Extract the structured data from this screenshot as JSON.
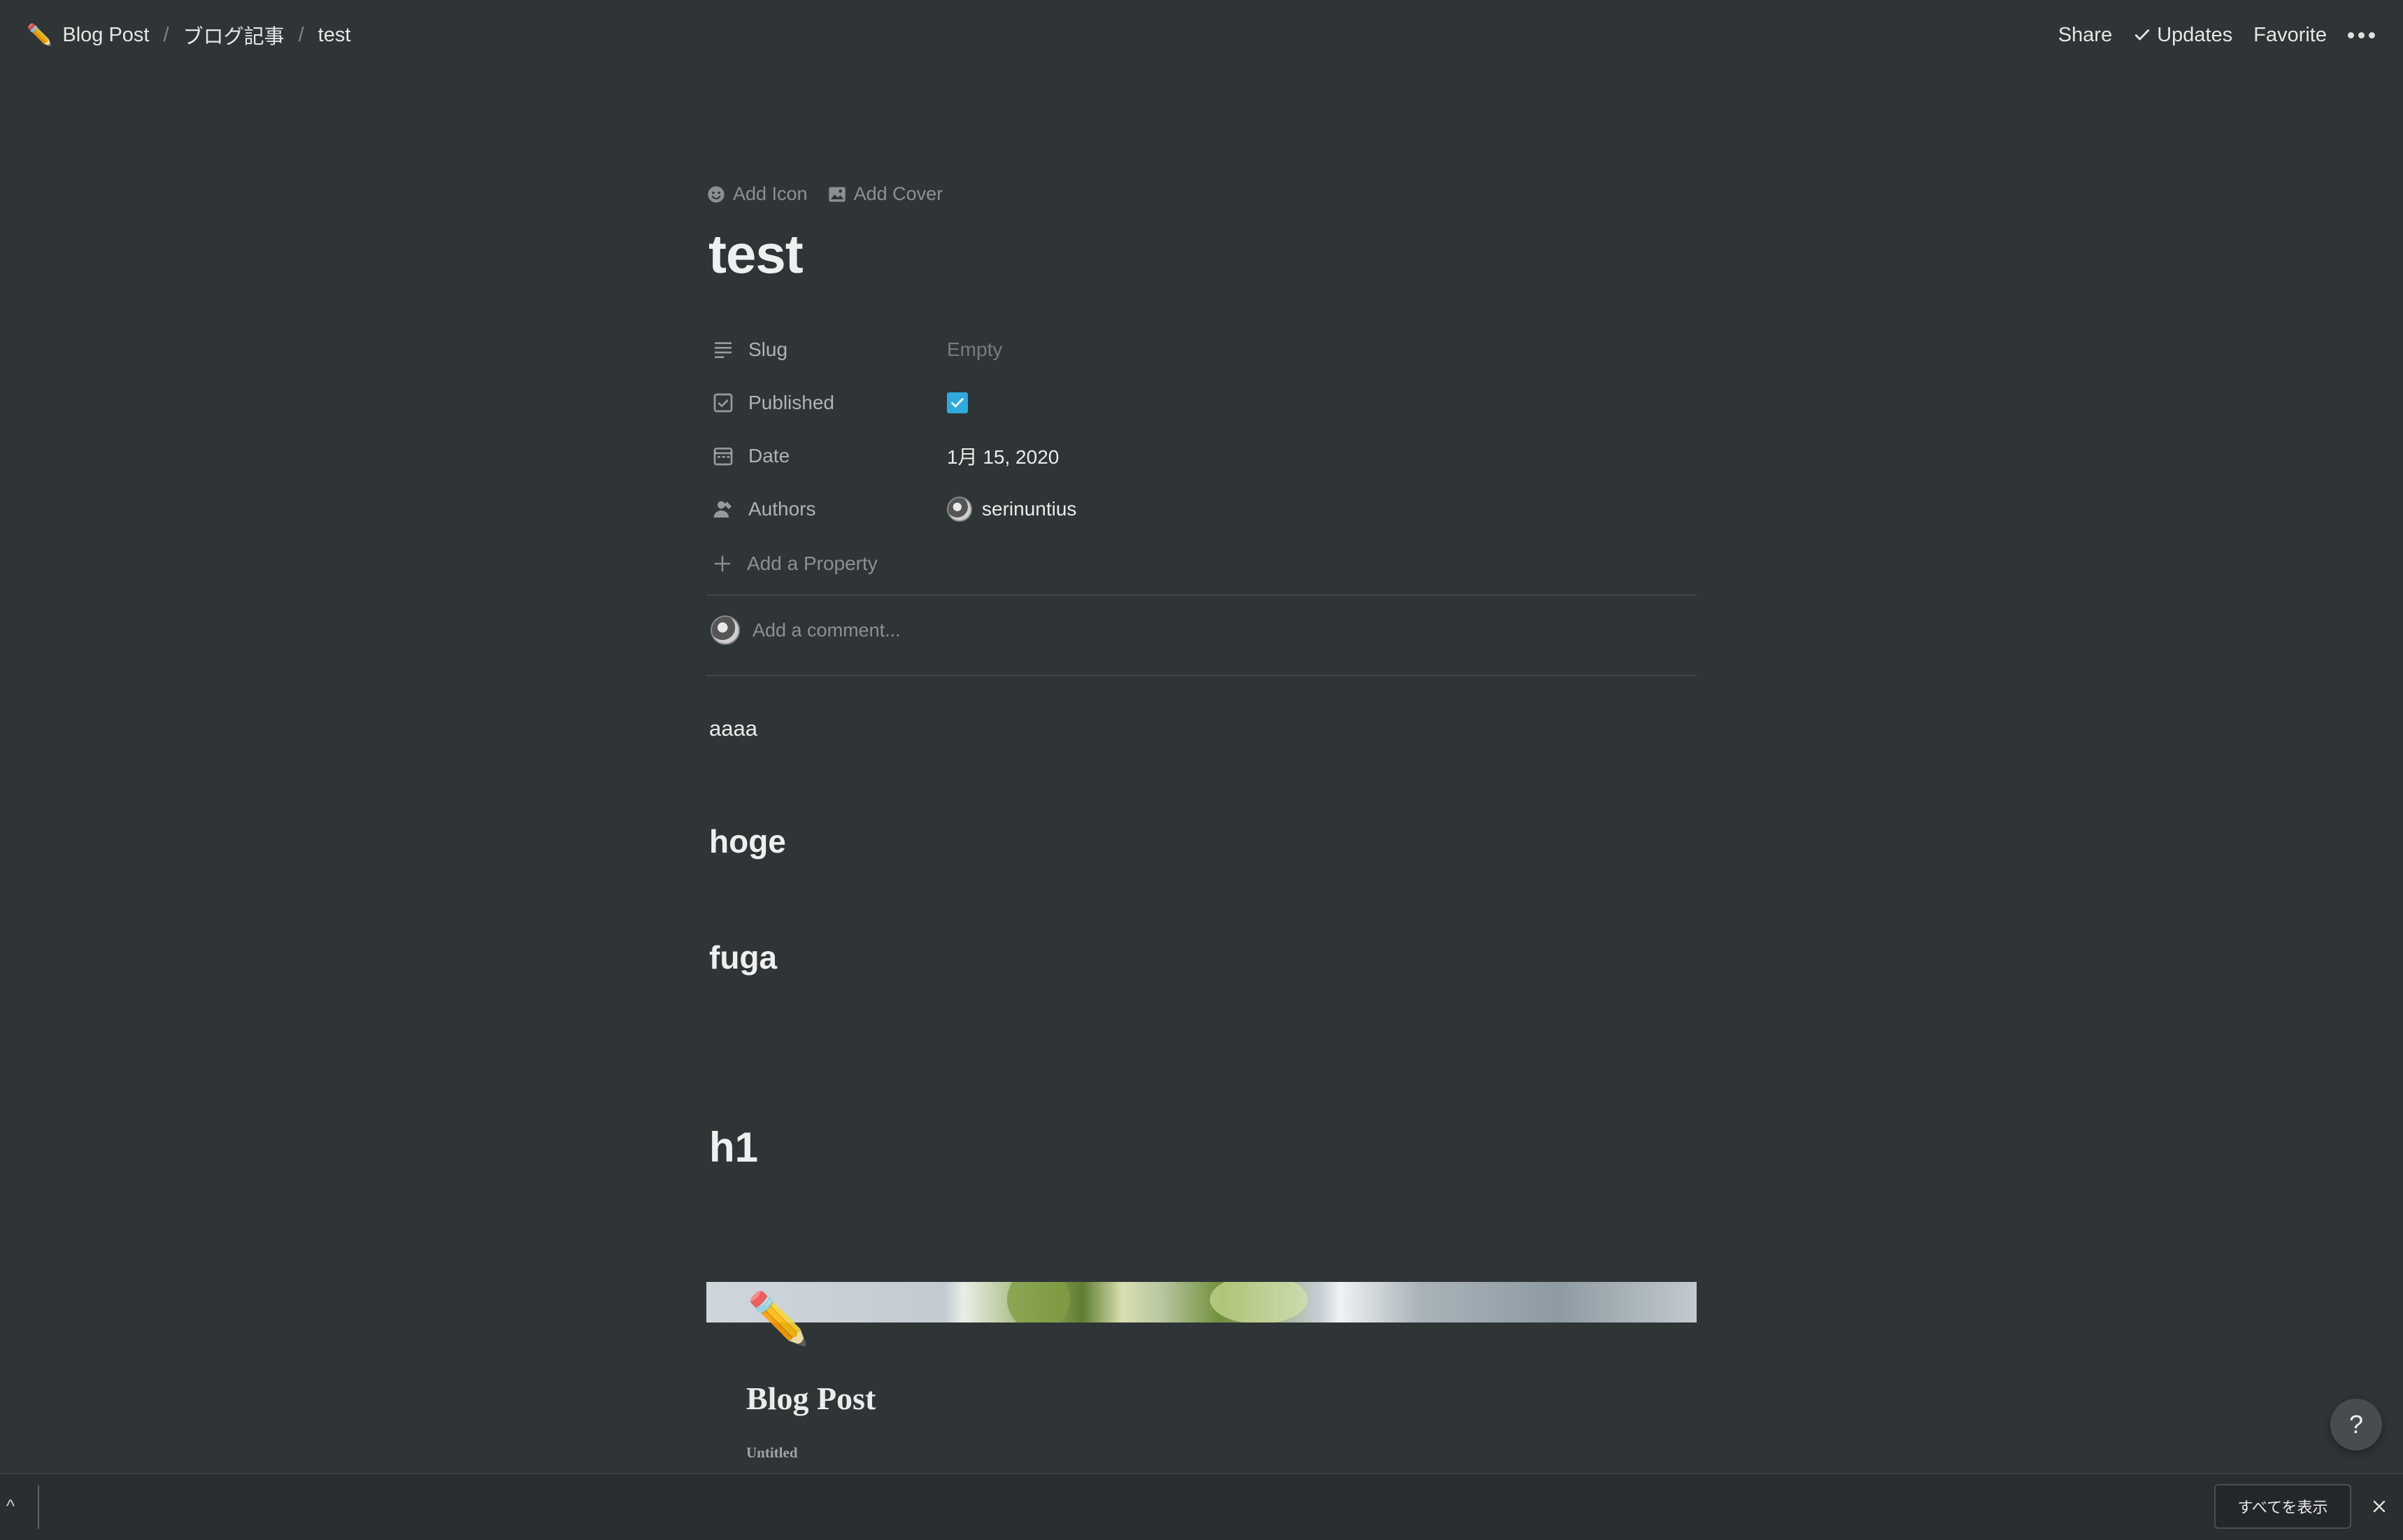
{
  "breadcrumb": {
    "items": [
      {
        "emoji": "✏️",
        "label": "Blog Post"
      },
      {
        "label": "ブログ記事"
      },
      {
        "label": "test"
      }
    ],
    "separator": "/"
  },
  "topbar": {
    "share_label": "Share",
    "updates_label": "Updates",
    "favorite_label": "Favorite"
  },
  "page_controls": {
    "add_icon_label": "Add Icon",
    "add_cover_label": "Add Cover"
  },
  "page": {
    "title": "test"
  },
  "properties": [
    {
      "name": "Slug",
      "icon": "text-lines-icon",
      "value": "Empty"
    },
    {
      "name": "Published",
      "icon": "checkbox-icon",
      "value": true
    },
    {
      "name": "Date",
      "icon": "calendar-icon",
      "value": "1月 15, 2020"
    },
    {
      "name": "Authors",
      "icon": "person-icon",
      "value": "serinuntius"
    }
  ],
  "add_property_label": "Add a Property",
  "comment": {
    "placeholder": "Add a comment..."
  },
  "content": {
    "paragraph": "aaaa",
    "heading3_1": "hoge",
    "heading3_2": "fuga",
    "heading1": "h1"
  },
  "embed": {
    "emoji": "✏️",
    "title": "Blog Post",
    "subtitle": "Untitled"
  },
  "help_label": "?",
  "bottom_bar": {
    "show_all_label": "すべてを表示",
    "caret": "^"
  },
  "colors": {
    "background": "#2f3437",
    "checkbox": "#2eaadc"
  }
}
